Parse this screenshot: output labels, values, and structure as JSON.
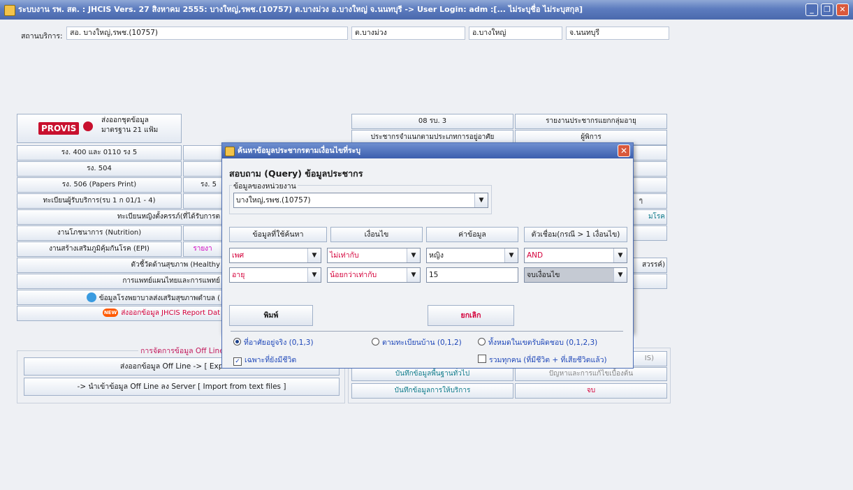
{
  "window": {
    "title": "ระบบงาน รพ. สต. : JHCIS Vers. 27 สิงหาคม 2555: บางใหญ่,รพช.(10757) ต.บางม่วง อ.บางใหญ่ จ.นนทบุรี -> User Login: adm :[... ไม่ระบุชื่อ  ไม่ระบุสกุล]",
    "min": "_",
    "max": "❐",
    "close": "✕"
  },
  "service_unit": {
    "label": "สถานบริการ:",
    "value": "สอ. บางใหญ่,รพช.(10757)",
    "tambon": "ต.บางม่วง",
    "amphoe": "อ.บางใหญ่",
    "province": "จ.นนทบุรี"
  },
  "provis": {
    "logo": "PROVIS",
    "line1": "ส่งออกชุดข้อมูล",
    "line2": "มาตรฐาน 21 แฟ้ม"
  },
  "left_buttons": {
    "rs400": "รง. 400 และ 0110 รง 5",
    "rs504": "รง. 504",
    "rs506": "รง. 506 (Papers Print)",
    "rs5_partial": "รง. 5",
    "register": "ทะเบียนผู้รับบริการ(รบ 1 ก 01/1 - 4)",
    "pregnant": "ทะเบียนหญิงตั้งครรภ์(ที่ได้รับการต",
    "nutrition": "งานโภชนาการ (Nutrition)",
    "epi": "งานสร้างเสริมภูมิคุ้มกันโรค (EPI)",
    "epi_report": "รายงา",
    "healthy": "ตัวชี้วัดด้านสุขภาพ (Healthy",
    "thai_med": "การแพทย์แผนไทยและการแพทย์",
    "hospital_info": "ข้อมูลโรงพยาบาลส่งเสริมสุขภาพตำบล (",
    "export_report": "ส่งออกข้อมูล JHCIS Report Dat",
    "new_badge": "NEW"
  },
  "right_buttons": {
    "rb3": "08 รบ. 3",
    "age_report": "รายงานประชากรแยกกลุ่มอายุ",
    "population_type": "ประชากรจำแนกตามประเภทการอยู่อาศัย",
    "disabled": "ผู้พิการ",
    "partial_n": "ๆ",
    "partial_disease": "มโรค",
    "partial_heaven": "สวรรค์)",
    "partial_is": "IS)",
    "record_general": "บันทึกข้อมูลพื้นฐานทั่วไป",
    "problems": "ปัญหาและการแก้ไขเบื้องต้น",
    "record_service": "บันทึกข้อมูลการให้บริการ",
    "exit": "จบ"
  },
  "offline": {
    "group_title": "การจัดการข้อมูล Off Line",
    "export": "ส่งออกข้อมูล Off Line -> [ Export to",
    "import": "-> นำเข้าข้อมูล Off Line ลง Server [ Import from text files ]"
  },
  "dialog": {
    "title": "ค้นหาข้อมูลประชากรตามเงื่อนไขที่ระบุ",
    "heading": "สอบถาม (Query) ข้อมูลประชากร",
    "unit_group": "ข้อมูลของหน่วยงาน",
    "unit_value": "บางใหญ่,รพช.(10757)",
    "headers": {
      "field": "ข้อมูลที่ใช้ค้นหา",
      "condition": "เงื่อนไข",
      "value": "ค่าข้อมูล",
      "connector": "ตัวเชื่อม(กรณี > 1 เงื่อนไข)"
    },
    "rows": [
      {
        "field": "เพศ",
        "condition": "ไม่เท่ากับ",
        "value": "หญิง",
        "connector": "AND"
      },
      {
        "field": "อายุ",
        "condition": "น้อยกว่าเท่ากับ",
        "value": "15",
        "connector": "จบเงื่อนไข"
      }
    ],
    "print": "พิมพ์",
    "cancel": "ยกเลิก",
    "radio_actual": "ที่อาศัยอยู่จริง (0,1,3)",
    "radio_register": "ตามทะเบียนบ้าน (0,1,2)",
    "radio_all": "ทั้งหมดในเขตรับผิดชอบ (0,1,2,3)",
    "check_alive": "เฉพาะที่ยังมีชีวิต",
    "check_all": "รวมทุกคน (ที่มีชีวิต + ที่เสียชีวิตแล้ว)"
  }
}
